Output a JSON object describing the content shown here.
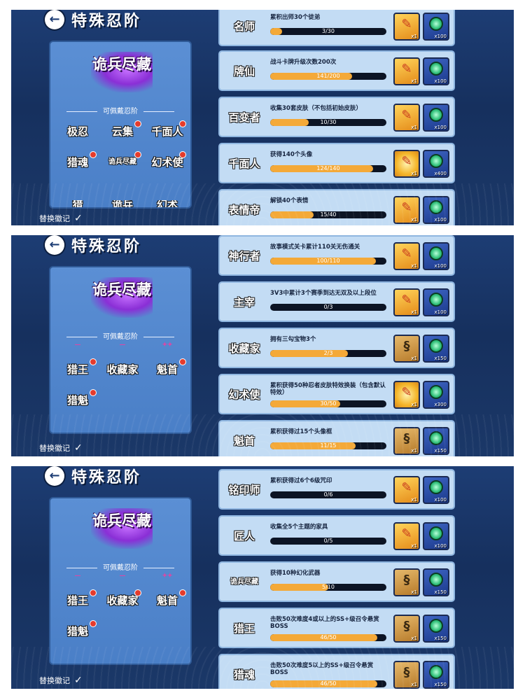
{
  "title": "特殊忍阶",
  "big_badge": "诡兵尽藏",
  "equip_label": "可佩戴忍阶",
  "replace_label": "替换徽记",
  "check": "✓",
  "colors": {
    "panel_bg": "#1d3d74",
    "card_bg": "#c3dcf4",
    "bar_fill": "#f4a938",
    "bar_track": "#0c1424",
    "red_dot": "#e53b2c"
  },
  "panels": [
    {
      "badges": [
        {
          "label": "极忍",
          "dot": false
        },
        {
          "label": "云集",
          "dot": true
        },
        {
          "label": "千面人",
          "dot": true
        },
        {
          "label": "猎魂",
          "dot": true
        },
        {
          "label": "诡兵尽藏",
          "dot": true
        },
        {
          "label": "幻术使",
          "dot": true
        }
      ],
      "achievements": [
        {
          "emblem": "名师",
          "desc": "累积出师30个徒弟",
          "progress": "3/30",
          "fill": 0.1,
          "r1_icon": "scroll-icon",
          "r1_qty": "x1",
          "r2_qty": "x100"
        },
        {
          "emblem": "牌仙",
          "desc": "战斗卡牌升级次数200次",
          "progress": "141/200",
          "fill": 0.705,
          "r1_icon": "scroll-icon",
          "r1_qty": "x1",
          "r2_qty": "x100"
        },
        {
          "emblem": "百变者",
          "desc": "收集30套皮肤（不包括初始皮肤）",
          "progress": "10/30",
          "fill": 0.333,
          "r1_icon": "scroll-icon",
          "r1_qty": "x1",
          "r2_qty": "x100"
        },
        {
          "emblem": "千面人",
          "desc": "获得140个头像",
          "progress": "124/140",
          "fill": 0.886,
          "r1_icon": "glow-scroll-icon",
          "r1_qty": "x1",
          "r2_qty": "x400"
        },
        {
          "emblem": "表情帝",
          "desc": "解锁40个表情",
          "progress": "15/40",
          "fill": 0.375,
          "r1_icon": "scroll-icon",
          "r1_qty": "x1",
          "r2_qty": "x100"
        }
      ]
    },
    {
      "badges": [
        {
          "label": "猎王",
          "dot": true
        },
        {
          "label": "收藏家",
          "dot": false
        },
        {
          "label": "魁首",
          "dot": true
        },
        {
          "label": "猎魁",
          "dot": true
        }
      ],
      "achievements": [
        {
          "emblem": "神行者",
          "desc": "故事模式关卡累计110关无伤通关",
          "progress": "100/110",
          "fill": 0.909,
          "r1_icon": "scroll-icon",
          "r1_qty": "x1",
          "r2_qty": "x100"
        },
        {
          "emblem": "主宰",
          "desc": "3V3中累计3个赛季到达无双及以上段位",
          "progress": "0/3",
          "fill": 0,
          "r1_icon": "scroll-icon",
          "r1_qty": "x1",
          "r2_qty": "x100"
        },
        {
          "emblem": "收藏家",
          "desc": "拥有三勾宝物3个",
          "progress": "2/3",
          "fill": 0.667,
          "r1_icon": "tool-icon",
          "r1_qty": "x1",
          "r2_qty": "x150"
        },
        {
          "emblem": "幻术使",
          "desc": "累积获得50种忍者皮肤特效换装（包含默认特效）",
          "progress": "30/50",
          "fill": 0.6,
          "r1_icon": "glow-scroll-icon",
          "r1_qty": "x1",
          "r2_qty": "x300"
        },
        {
          "emblem": "魁首",
          "desc": "累积获得过15个头像框",
          "progress": "11/15",
          "fill": 0.733,
          "r1_icon": "tool-icon",
          "r1_qty": "x1",
          "r2_qty": "x150"
        }
      ]
    },
    {
      "badges": [
        {
          "label": "猎王",
          "dot": true
        },
        {
          "label": "收藏家",
          "dot": true
        },
        {
          "label": "魁首",
          "dot": true
        },
        {
          "label": "猎魁",
          "dot": true
        }
      ],
      "achievements": [
        {
          "emblem": "铭印师",
          "desc": "累积获得过6个6级咒印",
          "progress": "0/6",
          "fill": 0,
          "r1_icon": "scroll-icon",
          "r1_qty": "x1",
          "r2_qty": "x100"
        },
        {
          "emblem": "匠人",
          "desc": "收集全5个主题的家具",
          "progress": "0/5",
          "fill": 0,
          "r1_icon": "scroll-icon",
          "r1_qty": "x1",
          "r2_qty": "x100"
        },
        {
          "emblem": "诡兵尽藏",
          "desc": "获得10种幻化武器",
          "progress": "5/10",
          "fill": 0.5,
          "r1_icon": "tool-icon",
          "r1_qty": "x1",
          "r2_qty": "x150"
        },
        {
          "emblem": "猎王",
          "desc": "击败50次难度4或以上的SS+级召令悬赏BOSS",
          "progress": "46/50",
          "fill": 0.92,
          "r1_icon": "tool-icon",
          "r1_qty": "x1",
          "r2_qty": "x150"
        },
        {
          "emblem": "猎魂",
          "desc": "击败50次难度5以上的SS+级召令悬赏BOSS",
          "progress": "46/50",
          "fill": 0.92,
          "r1_icon": "tool-icon",
          "r1_qty": "x1",
          "r2_qty": "x150"
        }
      ]
    }
  ]
}
